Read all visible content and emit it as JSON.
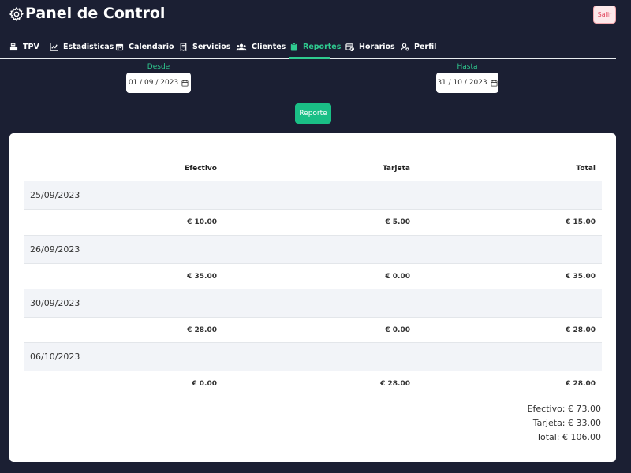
{
  "header": {
    "title": "Panel de Control",
    "logout_label": "Salir"
  },
  "nav": {
    "tabs": [
      {
        "label": "TPV",
        "icon": "cash-register-icon"
      },
      {
        "label": "Estadisticas",
        "icon": "chart-icon"
      },
      {
        "label": "Calendario",
        "icon": "calendar-icon"
      },
      {
        "label": "Servicios",
        "icon": "receipt-icon"
      },
      {
        "label": "Clientes",
        "icon": "users-icon"
      },
      {
        "label": "Reportes",
        "icon": "clipboard-icon",
        "active": true
      },
      {
        "label": "Horarios",
        "icon": "calendar-clock-icon"
      },
      {
        "label": "Perfil",
        "icon": "user-gear-icon"
      }
    ]
  },
  "filters": {
    "from_label": "Desde",
    "from_value": "01 / 09 / 2023",
    "to_label": "Hasta",
    "to_value": "31 / 10 / 2023",
    "report_button": "Reporte"
  },
  "table": {
    "headers": [
      "Efectivo",
      "Tarjeta",
      "Total"
    ],
    "rows": [
      {
        "date": "25/09/2023",
        "efectivo": "€ 10.00",
        "tarjeta": "€ 5.00",
        "total": "€ 15.00"
      },
      {
        "date": "26/09/2023",
        "efectivo": "€ 35.00",
        "tarjeta": "€ 0.00",
        "total": "€ 35.00"
      },
      {
        "date": "30/09/2023",
        "efectivo": "€ 28.00",
        "tarjeta": "€ 0.00",
        "total": "€ 28.00"
      },
      {
        "date": "06/10/2023",
        "efectivo": "€ 0.00",
        "tarjeta": "€ 28.00",
        "total": "€ 28.00"
      }
    ]
  },
  "summary": {
    "efectivo": "Efectivo: € 73.00",
    "tarjeta": "Tarjeta: € 33.00",
    "total": "Total: € 106.00"
  },
  "colors": {
    "background": "#1b1f33",
    "accent": "#2fcb90",
    "button": "#1abf86",
    "logout_bg": "#fde8ea",
    "logout_text": "#e0435a"
  }
}
